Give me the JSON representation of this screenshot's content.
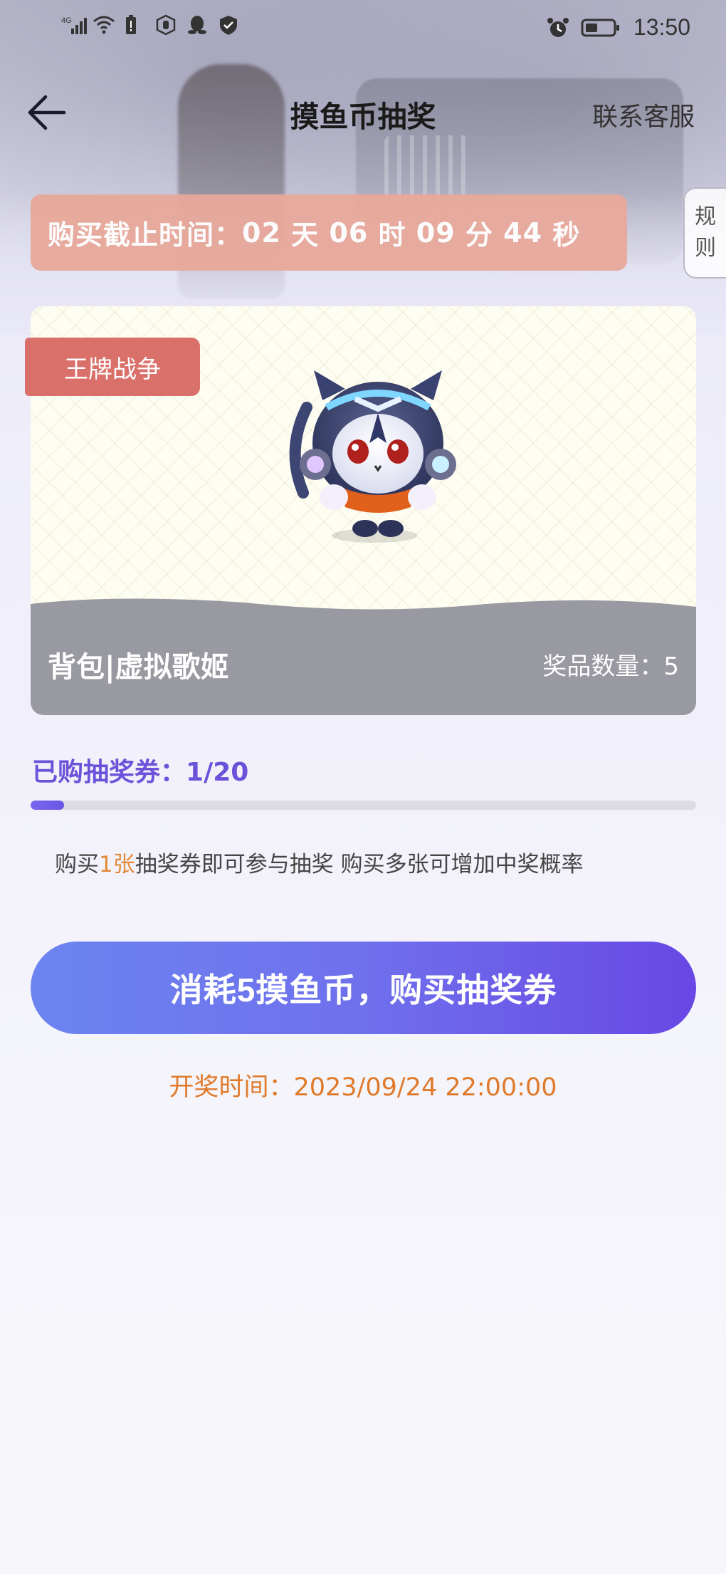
{
  "status_bar": {
    "network": "4G",
    "time": "13:50"
  },
  "header": {
    "title": "摸鱼币抽奖",
    "contact": "联系客服"
  },
  "rules_tab": {
    "line1": "规",
    "line2": "则"
  },
  "countdown": {
    "label": "购买截止时间：",
    "days": "02",
    "days_unit": "天",
    "hours": "06",
    "hours_unit": "时",
    "minutes": "09",
    "minutes_unit": "分",
    "seconds": "44",
    "seconds_unit": "秒"
  },
  "prize": {
    "game_tag": "王牌战争",
    "name": "背包|虚拟歌姬",
    "quantity_label": "奖品数量：",
    "quantity": "5"
  },
  "tickets": {
    "label": "已购抽奖券：",
    "bought": 1,
    "total": 20,
    "display": "1/20"
  },
  "hint": {
    "prefix": "购买",
    "highlight": "1张",
    "suffix": "抽奖券即可参与抽奖 购买多张可增加中奖概率"
  },
  "buy_button": {
    "label": "消耗5摸鱼币，购买抽奖券"
  },
  "draw_time": {
    "label": "开奖时间：",
    "value": "2023/09/24 22:00:00"
  },
  "colors": {
    "accent_purple": "#6b52d9",
    "countdown_bg": "#e8a89a",
    "tag_bg": "#d9706a",
    "highlight_orange": "#e28a3a",
    "draw_time_orange": "#e07a2a"
  }
}
